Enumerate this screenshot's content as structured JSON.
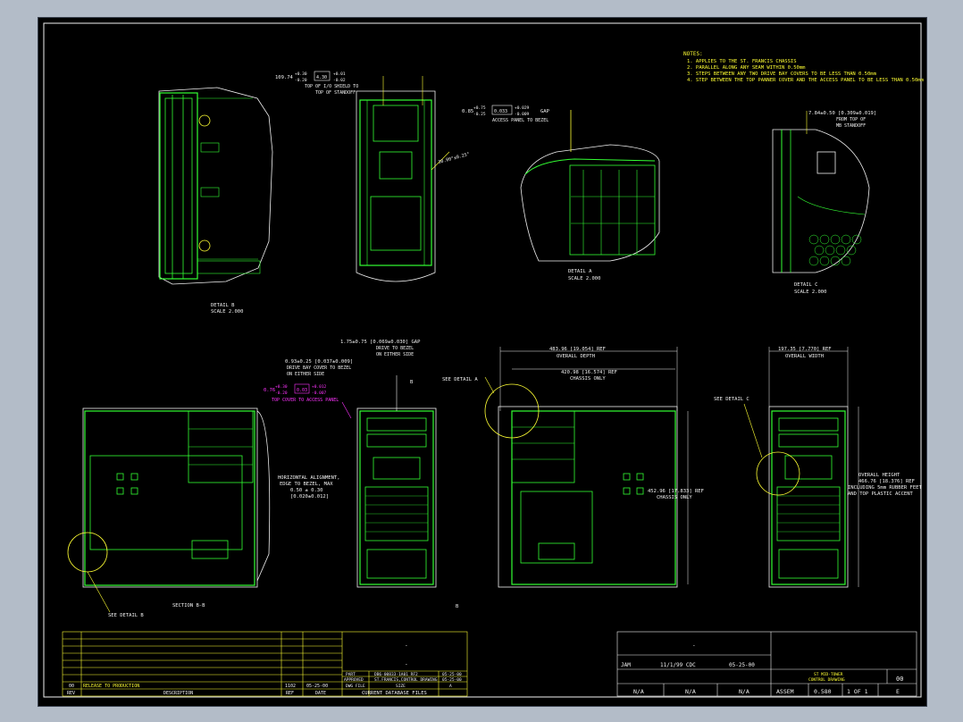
{
  "notes": {
    "title": "NOTES:",
    "lines": [
      "1. APPLIES TO THE ST. FRANCIS CHASSIS",
      "2. PARALLEL ALONG ANY SEAM WITHIN 0.50mm",
      "3. STEPS BETWEEN ANY TWO DRIVE BAY COVERS TO BE LESS THAN 0.50mm",
      "4. STEP BETWEEN THE TOP PANNER COVER AND THE ACCESS PANEL TO BE LESS THAN 0.50mm"
    ]
  },
  "details": {
    "b": {
      "title": "DETAIL B",
      "scale": "SCALE 2.000"
    },
    "a": {
      "title": "DETAIL A",
      "scale": "SCALE 2.000"
    },
    "c": {
      "title": "DETAIL C",
      "scale": "SCALE 2.000"
    }
  },
  "annotations": {
    "top_io_dim": "109.74",
    "top_io_tol_plus": "+0.30",
    "top_io_tol_minus": "-0.20",
    "top_io_box": "4.30",
    "top_io_box_tol_plus": "+0.01",
    "top_io_box_tol_minus": "-0.02",
    "top_io_l1": "TOP OF I/O SHIELD TO",
    "top_io_l2": "TOP OF STANDOFF",
    "angle": "30.00°±0.25°",
    "gap_a_dim": "0.85",
    "gap_a_tol_plus": "+0.75",
    "gap_a_tol_minus": "-0.25",
    "gap_a_box": "0.033",
    "gap_a_box_tol_plus": "+0.029",
    "gap_a_box_tol_minus": "-0.009",
    "gap_a_word": "GAP",
    "gap_a_desc": "ACCESS PANEL TO BEZEL",
    "c_dim": "7.84±0.50 [0.309±0.019]",
    "c_l1": "FROM TOP OF",
    "c_l2": "MB STANDOFF",
    "drive_gap_dim": "1.75±0.75 [0.069±0.030] GAP",
    "drive_gap_l1": "DRIVE TO BEZEL",
    "drive_gap_l2": "ON EITHER SIDE",
    "drive_bay_dim": "0.93±0.25 [0.037±0.009]",
    "drive_bay_l1": "DRIVE BAY COVER TO BEZEL",
    "drive_bay_l2": "ON EITHER SIDE",
    "top_cover_dim": "0.76",
    "top_cover_tol_plus": "+0.30",
    "top_cover_tol_minus": "-0.20",
    "top_cover_box": "0.03",
    "top_cover_box_tol_plus": "+0.012",
    "top_cover_box_tol_minus": "-0.007",
    "top_cover_desc": "TOP COVER TO ACCESS PANEL",
    "horiz_l1": "HORIZONTAL ALIGNMENT,",
    "horiz_l2": "EDGE TO BEZEL, MAX",
    "horiz_l3": "0.50 ± 0.30",
    "horiz_l4": "[0.020±0.012]",
    "see_detail_a": "SEE DETAIL A",
    "see_detail_b": "SEE DETAIL B",
    "see_detail_c": "SEE DETAIL C",
    "section_label": "SECTION B-B",
    "section_marker": "B",
    "overall_depth_dim": "483.96 [19.054] REF",
    "overall_depth_label": "OVERALL DEPTH",
    "chassis_depth_dim": "420.98 [16.574] REF",
    "chassis_depth_label": "CHASSIS ONLY",
    "chassis_height_dim": "452.96 [17.833] REF",
    "chassis_height_label": "CHASSIS ONLY",
    "overall_width_dim": "197.35 [7.770] REF",
    "overall_width_label": "OVERALL WIDTH",
    "overall_height_l1": "OVERALL HEIGHT",
    "overall_height_l2": "466.76 [18.376] REF",
    "overall_height_l3": "INCLUDING 5mm RUBBER FEET",
    "overall_height_l4": "AND TOP PLASTIC ACCENT"
  },
  "title_block": {
    "rev_row": {
      "rev": "00",
      "description": "RELEASE TO PRODUCTION",
      "ecr": "",
      "date": ""
    },
    "headers": {
      "rev": "REV",
      "description": "DESCRIPTION",
      "ref": "REF",
      "date": "DATE"
    },
    "ecn": "1102",
    "ecn_date": "05-25-00",
    "dash1": "-",
    "dash2": "-",
    "part_label": "PART",
    "part_value": "DB6-00833-1A01 RF2",
    "approved_label": "APPROVED",
    "approved_value": "ST.FRANCIS,CONTROL DRAWING",
    "file_label": "DWG FILE",
    "part_date": "05-25-00",
    "appr_date": "05-25-00",
    "size_label": "SIZE",
    "size_val": "A",
    "database": "CURRENT DATABASE FILES",
    "author": "JAM",
    "drawn_date": "11/1/99 CDC",
    "checked_date": "05-25-00",
    "dash3": "-",
    "drawing_title_l1": "ST MID-TOWER",
    "drawing_title_l2": "CONTROL DRAWING",
    "rev_code": "00",
    "cells": [
      "N/A",
      "N/A",
      "N/A",
      "ASSEM",
      "0.580",
      "1 OF 1",
      "E"
    ]
  },
  "colors": {
    "background": "#000000",
    "geometry": "#33ff33",
    "annotation": "#ffff33",
    "highlight": "#ff33ff",
    "frame_bg": "#b3bcc8"
  }
}
